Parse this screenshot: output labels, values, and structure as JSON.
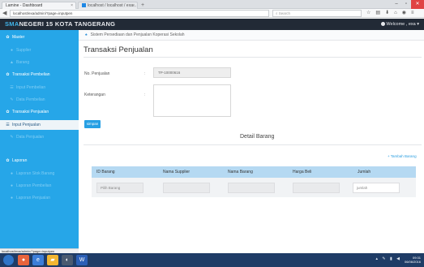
{
  "browser": {
    "tabs": [
      {
        "label": "Lamine - Dashboard",
        "active": true
      },
      {
        "label": "localhost / localhost / exa...",
        "active": false
      }
    ],
    "url": "localhost/exa/admin/?page=inputpen",
    "search_placeholder": "Search"
  },
  "app": {
    "brand_prefix": "SMA",
    "brand_rest": "NEGERI 15 KOTA TANGERANG",
    "welcome": "Welcome , exa"
  },
  "sidebar": {
    "items": [
      {
        "label": "Master",
        "type": "section",
        "icon": "gear-icon"
      },
      {
        "label": "Supplier",
        "type": "sub",
        "icon": "user-icon"
      },
      {
        "label": "Barang",
        "type": "sub",
        "icon": "box-icon"
      },
      {
        "label": "Transaksi Pembelian",
        "type": "section",
        "icon": "gear-icon"
      },
      {
        "label": "Input Pembelian",
        "type": "sub",
        "icon": "list-icon"
      },
      {
        "label": "Data Pembelian",
        "type": "sub",
        "icon": "pencil-icon"
      },
      {
        "label": "Transaksi Penjualan",
        "type": "section",
        "icon": "gear-icon"
      },
      {
        "label": "Input Penjualan",
        "type": "active",
        "icon": "list-icon"
      },
      {
        "label": "Data Penjualan",
        "type": "sub",
        "icon": "pencil-icon"
      },
      {
        "label": "Laporan",
        "type": "section",
        "icon": "gear-icon"
      },
      {
        "label": "Laporan Stok Barang",
        "type": "sub",
        "icon": "circle-icon"
      },
      {
        "label": "Laporan Pembelian",
        "type": "sub",
        "icon": "circle-icon"
      },
      {
        "label": "Laporan Penjualan",
        "type": "sub",
        "icon": "circle-icon"
      }
    ],
    "status_url": "localhost/exa/admin/?page=inputpen"
  },
  "breadcrumb": "Sistem Persediaan dan Penjualan Koperasi Sekolah",
  "page_title": "Transaksi Penjualan",
  "form": {
    "no_label": "No. Penjualan",
    "no_value": "TP-10000616",
    "ket_label": "Keterangan",
    "ket_value": "",
    "simpan": "simpan"
  },
  "detail": {
    "title": "Detail Barang",
    "add_button": "+ Tambah Barang",
    "columns": [
      "ID Barang",
      "Nama Supplier",
      "Nama Barang",
      "Harga Beli",
      "Jumlah"
    ],
    "row": {
      "id_placeholder": "Pilih Barang",
      "jumlah_placeholder": "jumlah"
    }
  },
  "taskbar": {
    "time": "09:31",
    "date": "06/06/2016"
  }
}
